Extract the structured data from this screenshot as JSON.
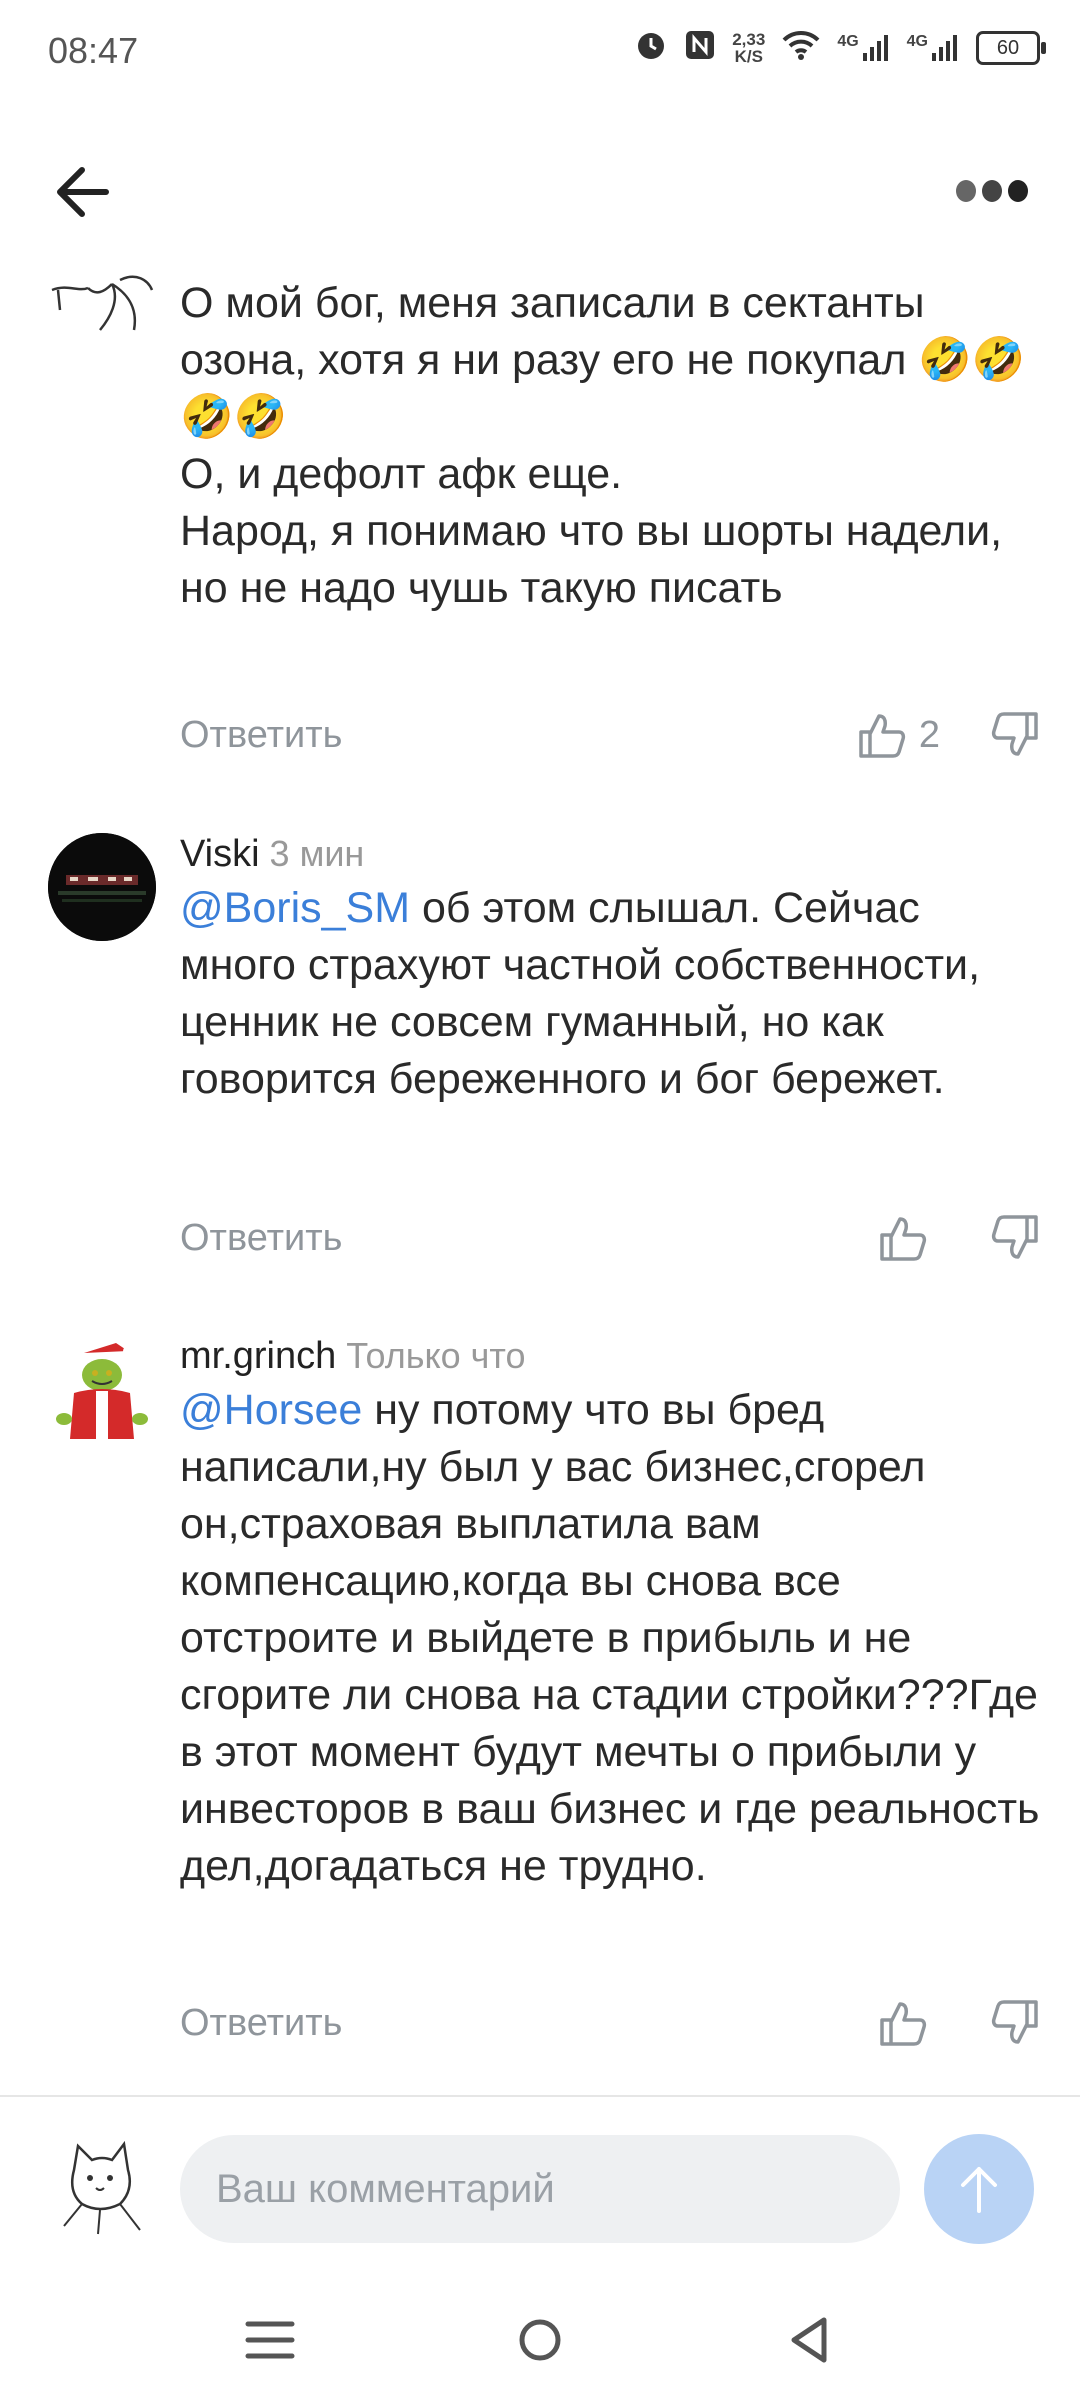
{
  "status_bar": {
    "time": "08:47",
    "net_speed_top": "2,33",
    "net_speed_bottom": "K/S",
    "net1": "4G",
    "net2": "4G",
    "battery": "60"
  },
  "comments": [
    {
      "author": "",
      "time": "",
      "mention": "",
      "text": "О мой бог, меня записали в сектанты озона, хотя я ни разу его не покупал 🤣🤣🤣🤣\nО, и дефолт афк еще.\nНарод, я понимаю что вы шорты надели, но не надо чушь такую писать",
      "reply_label": "Ответить",
      "likes": "2"
    },
    {
      "author": "Viski",
      "time": "3 мин",
      "mention": "@Boris_SM",
      "text": " об этом слышал. Сейчас много страхуют частной собственности, ценник не совсем гуманный, но как говорится береженного и бог бережет.",
      "reply_label": "Ответить",
      "likes": ""
    },
    {
      "author": "mr.grinch",
      "time": "Только что",
      "mention": "@Horsee",
      "text": " ну потому что вы бред написали,ну был у вас бизнес,сгорел он,страховая выплатила вам компенсацию,когда вы снова все отстроите и выйдете в прибыль и не сгорите ли снова на стадии стройки???Где в этот момент будут мечты о прибыли у инвесторов в ваш бизнес и где реальность дел,догадаться не трудно.",
      "reply_label": "Ответить",
      "likes": ""
    }
  ],
  "composer": {
    "placeholder": "Ваш комментарий",
    "send_color": "#b9d3f5"
  },
  "colors": {
    "mention": "#3b7fd9",
    "muted": "#8f959b"
  }
}
